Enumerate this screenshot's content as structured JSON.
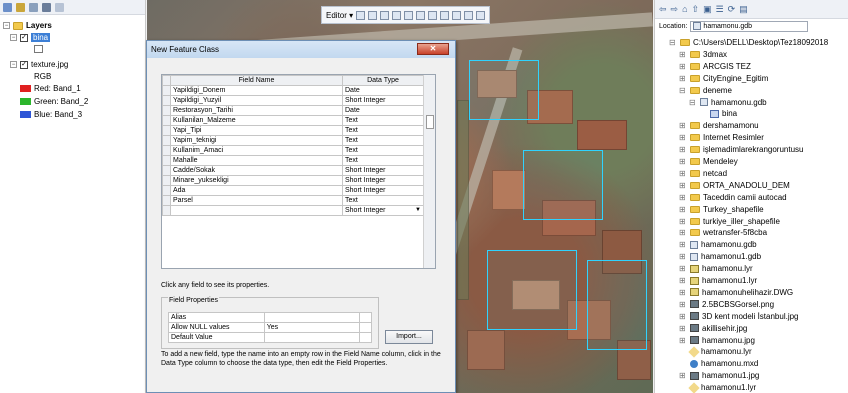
{
  "toc": {
    "root_label": "Layers",
    "layer1": "bina",
    "layer2": "texture.jpg",
    "rgb_label": "RGB",
    "bands": [
      {
        "label": "Red:   Band_1",
        "color": "#e02020"
      },
      {
        "label": "Green: Band_2",
        "color": "#2cb52c"
      },
      {
        "label": "Blue:  Band_3",
        "color": "#2d55d6"
      }
    ]
  },
  "editor": {
    "label": "Editor ▾"
  },
  "dialog": {
    "title": "New Feature Class",
    "close": "✕",
    "columns": [
      "Field Name",
      "Data Type"
    ],
    "rows": [
      [
        "Yapildigi_Donem",
        "Date"
      ],
      [
        "Yapildigi_Yuzyil",
        "Short Integer"
      ],
      [
        "Restorasyon_Tarihi",
        "Date"
      ],
      [
        "Kullanilan_Malzeme",
        "Text"
      ],
      [
        "Yapi_Tipi",
        "Text"
      ],
      [
        "Yapim_teknigi",
        "Text"
      ],
      [
        "Kullanim_Amaci",
        "Text"
      ],
      [
        "Mahalle",
        "Text"
      ],
      [
        "Cadde/Sokak",
        "Short Integer"
      ],
      [
        "Minare_yuksekligi",
        "Short Integer"
      ],
      [
        "Ada",
        "Short Integer"
      ],
      [
        "Parsel",
        "Text"
      ],
      [
        "",
        "Short Integer"
      ]
    ],
    "help_select": "Click any field to see its properties.",
    "field_properties_label": "Field Properties",
    "properties": [
      [
        "Alias",
        ""
      ],
      [
        "Allow NULL values",
        "Yes"
      ],
      [
        "Default Value",
        ""
      ]
    ],
    "import_label": "Import...",
    "help_add": "To add a new field, type the name into an empty row in the Field Name column, click in the Data Type column to choose the data type, then edit the Field Properties."
  },
  "catalog": {
    "location_label": "Location:",
    "location_value": "hamamonu.gdb",
    "items": [
      {
        "label": "C:\\Users\\DELL\\Desktop\\Tez18092018",
        "icon": "folder",
        "indent": 0,
        "exp": "⊟"
      },
      {
        "label": "3dmax",
        "icon": "folder",
        "indent": 1,
        "exp": "⊞"
      },
      {
        "label": "ARCGIS TEZ",
        "icon": "folder",
        "indent": 1,
        "exp": "⊞"
      },
      {
        "label": "CityEngine_Egitim",
        "icon": "folder",
        "indent": 1,
        "exp": "⊞"
      },
      {
        "label": "deneme",
        "icon": "folder",
        "indent": 1,
        "exp": "⊟"
      },
      {
        "label": "hamamonu.gdb",
        "icon": "gdb",
        "indent": 2,
        "exp": "⊟"
      },
      {
        "label": "bina",
        "icon": "fc",
        "indent": 3,
        "exp": ""
      },
      {
        "label": "dershamamonu",
        "icon": "folder",
        "indent": 1,
        "exp": "⊞"
      },
      {
        "label": "Internet Resimler",
        "icon": "folder",
        "indent": 1,
        "exp": "⊞"
      },
      {
        "label": "işlemadimlarekrangoruntusu",
        "icon": "folder",
        "indent": 1,
        "exp": "⊞"
      },
      {
        "label": "Mendeley",
        "icon": "folder",
        "indent": 1,
        "exp": "⊞"
      },
      {
        "label": "netcad",
        "icon": "folder",
        "indent": 1,
        "exp": "⊞"
      },
      {
        "label": "ORTA_ANADOLU_DEM",
        "icon": "folder",
        "indent": 1,
        "exp": "⊞"
      },
      {
        "label": "Taceddin camii autocad",
        "icon": "folder",
        "indent": 1,
        "exp": "⊞"
      },
      {
        "label": "Turkey_shapefile",
        "icon": "folder",
        "indent": 1,
        "exp": "⊞"
      },
      {
        "label": "turkiye_iller_shapefile",
        "icon": "folder",
        "indent": 1,
        "exp": "⊞"
      },
      {
        "label": "wetransfer-5f8cba",
        "icon": "folder",
        "indent": 1,
        "exp": "⊞"
      },
      {
        "label": "hamamonu.gdb",
        "icon": "gdb",
        "indent": 1,
        "exp": "⊞"
      },
      {
        "label": "hamamonu1.gdb",
        "icon": "gdb",
        "indent": 1,
        "exp": "⊞"
      },
      {
        "label": "hamamonu.lyr",
        "icon": "lyr",
        "indent": 1,
        "exp": "⊞"
      },
      {
        "label": "hamamonu1.lyr",
        "icon": "lyr",
        "indent": 1,
        "exp": "⊞"
      },
      {
        "label": "hamamonuhelihazir.DWG",
        "icon": "lyr",
        "indent": 1,
        "exp": "⊞"
      },
      {
        "label": "2.5BCBSGorsel.png",
        "icon": "raster",
        "indent": 1,
        "exp": "⊞"
      },
      {
        "label": "3D kent modeli İstanbul.jpg",
        "icon": "raster",
        "indent": 1,
        "exp": "⊞"
      },
      {
        "label": "akillisehir.jpg",
        "icon": "raster",
        "indent": 1,
        "exp": "⊞"
      },
      {
        "label": "hamamonu.jpg",
        "icon": "raster",
        "indent": 1,
        "exp": "⊞"
      },
      {
        "label": "hamamonu.lyr",
        "icon": "mxd",
        "indent": 1,
        "exp": ""
      },
      {
        "label": "hamamonu.mxd",
        "icon": "mxdb",
        "indent": 1,
        "exp": ""
      },
      {
        "label": "hamamonu1.jpg",
        "icon": "raster",
        "indent": 1,
        "exp": "⊞"
      },
      {
        "label": "hamamonu1.lyr",
        "icon": "mxd",
        "indent": 1,
        "exp": ""
      }
    ]
  }
}
